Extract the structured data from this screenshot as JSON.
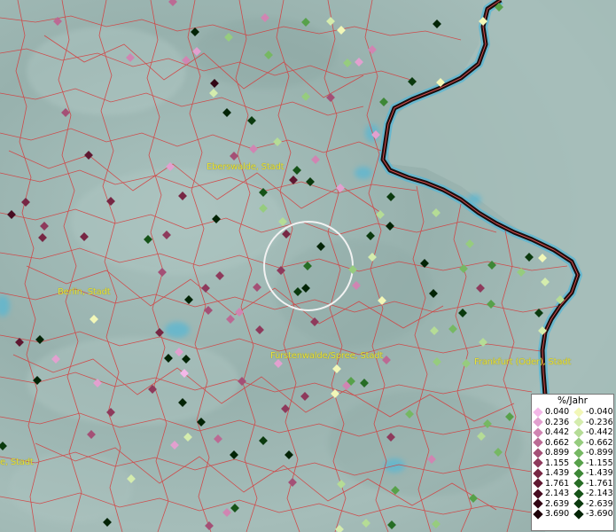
{
  "map": {
    "cities": [
      {
        "label": "Eberswalde, Stadt"
      },
      {
        "label": "Berlin, Stadt"
      },
      {
        "label": "Fürstenwalde/Spree, Stadt"
      },
      {
        "label": "Frankfurt (Oder), Stadt"
      },
      {
        "label": "e, Stadt"
      }
    ]
  },
  "legend": {
    "title": "%/Jahr",
    "rows": [
      {
        "pos": "0.040",
        "pos_color": "#f4b8e8",
        "neg": "-0.040",
        "neg_color": "#f2f7b8"
      },
      {
        "pos": "0.236",
        "pos_color": "#e2a0cf",
        "neg": "-0.236",
        "neg_color": "#d4ecad"
      },
      {
        "pos": "0.442",
        "pos_color": "#d085b2",
        "neg": "-0.442",
        "neg_color": "#b5dc96"
      },
      {
        "pos": "0.662",
        "pos_color": "#bb6a94",
        "neg": "-0.662",
        "neg_color": "#96cc7e"
      },
      {
        "pos": "0.899",
        "pos_color": "#a45076",
        "neg": "-0.899",
        "neg_color": "#76b863"
      },
      {
        "pos": "1.155",
        "pos_color": "#8e3a5c",
        "neg": "-1.155",
        "neg_color": "#57a14a"
      },
      {
        "pos": "1.439",
        "pos_color": "#772744",
        "neg": "-1.439",
        "neg_color": "#3d8736"
      },
      {
        "pos": "1.761",
        "pos_color": "#5f1831",
        "neg": "-1.761",
        "neg_color": "#276d25"
      },
      {
        "pos": "2.143",
        "pos_color": "#470c21",
        "neg": "-2.143",
        "neg_color": "#165318"
      },
      {
        "pos": "2.639",
        "pos_color": "#320514",
        "neg": "-2.639",
        "neg_color": "#0b3a0e"
      },
      {
        "pos": "3.690",
        "pos_color": "#1e0109",
        "neg": "-3.690",
        "neg_color": "#032406"
      }
    ]
  }
}
